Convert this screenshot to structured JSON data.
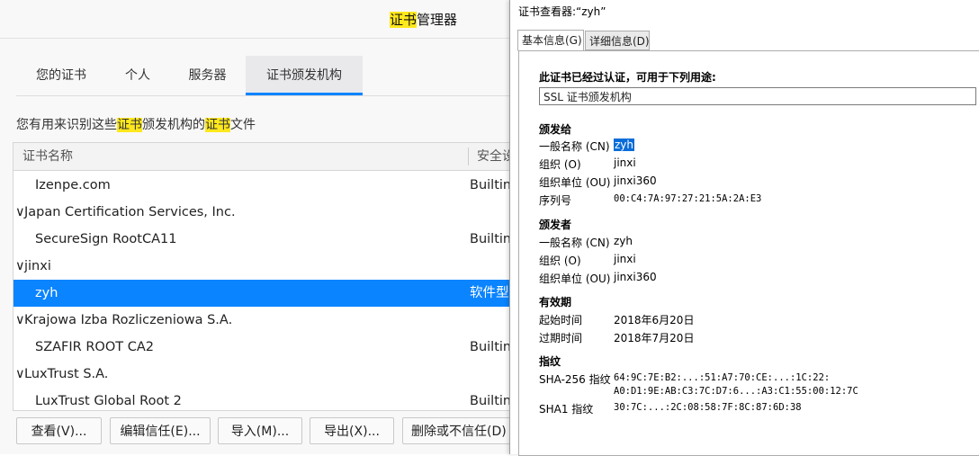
{
  "manager": {
    "title_hl": "证书",
    "title_rest": "管理器",
    "tabs": [
      {
        "label": "您的证书"
      },
      {
        "label": "个人"
      },
      {
        "label": "服务器"
      },
      {
        "label": "证书颁发机构"
      }
    ],
    "desc_parts": [
      "您有用来识别这些",
      "证书",
      "颁发机构的",
      "证书",
      "文件"
    ],
    "columns": {
      "name": "证书名称",
      "security": "安全设"
    },
    "rows": [
      {
        "name": "Izenpe.com",
        "security": "Builtin"
      },
      {
        "name": "Japan Certification Services, Inc.",
        "security": ""
      },
      {
        "name": "SecureSign RootCA11",
        "security": "Builtin"
      },
      {
        "name": "jinxi",
        "security": ""
      },
      {
        "name": "zyh",
        "security": "软件型"
      },
      {
        "name": "Krajowa Izba Rozliczeniowa S.A.",
        "security": ""
      },
      {
        "name": "SZAFIR ROOT CA2",
        "security": "Builtin"
      },
      {
        "name": "LuxTrust S.A.",
        "security": ""
      },
      {
        "name": "LuxTrust Global Root 2",
        "security": "Builtin"
      }
    ],
    "buttons": {
      "view": "查看(V)...",
      "edit_trust": "编辑信任(E)...",
      "import": "导入(M)...",
      "export": "导出(X)...",
      "delete": "删除或不信任(D)"
    }
  },
  "viewer": {
    "title": "证书查看器:“zyh”",
    "tabs": {
      "general": "基本信息(G)",
      "details": "详细信息(D)"
    },
    "verified_heading": "此证书已经过认证，可用于下列用途:",
    "usage": "SSL 证书颁发机构",
    "issued_to": {
      "heading": "颁发给",
      "cn_label": "一般名称 (CN)",
      "cn": "zyh",
      "o_label": "组织 (O)",
      "o": "jinxi",
      "ou_label": "组织单位 (OU)",
      "ou": "jinxi360",
      "serial_label": "序列号",
      "serial": "00:C4:7A:97:27:21:5A:2A:E3"
    },
    "issued_by": {
      "heading": "颁发者",
      "cn_label": "一般名称 (CN)",
      "cn": "zyh",
      "o_label": "组织 (O)",
      "o": "jinxi",
      "ou_label": "组织单位 (OU)",
      "ou": "jinxi360"
    },
    "validity": {
      "heading": "有效期",
      "start_label": "起始时间",
      "start": "2018年6月20日",
      "end_label": "过期时间",
      "end": "2018年7月20日"
    },
    "fingerprints": {
      "heading": "指纹",
      "sha256_label": "SHA-256 指纹",
      "sha256_line1": "64:9C:7E:B2:...:51:A7:70:CE:...:1C:22:",
      "sha256_line2": "A0:D1:9E:AB:C3:7C:D7:6...:A3:C1:55:00:12:7C",
      "sha1_label": "SHA1 指纹",
      "sha1": "30:7C:...:2C:08:58:7F:8C:87:6D:38"
    }
  },
  "colors": {
    "accent": "#0a84ff",
    "highlight": "#ffe81c",
    "selected_value": "#0a6cd8"
  }
}
